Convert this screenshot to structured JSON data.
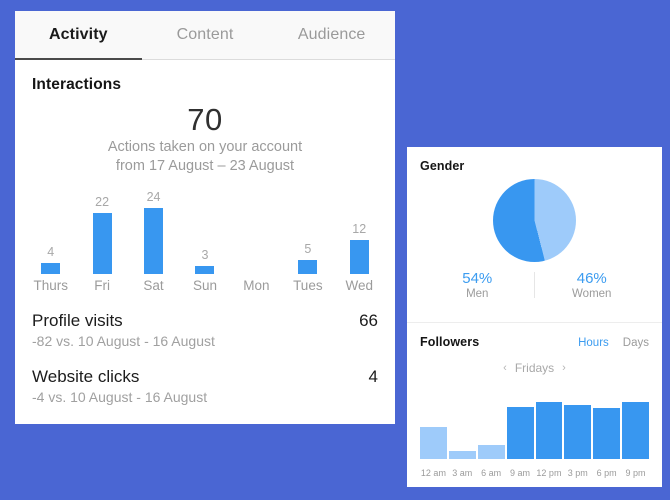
{
  "theme": {
    "background": "#4a66d3",
    "accent_blue": "#3897f0",
    "light_blue": "#9ecbfa",
    "text_dark": "#1c1c1c",
    "text_muted": "#9b9b9b"
  },
  "left_panel": {
    "tabs": [
      {
        "label": "Activity",
        "active": true
      },
      {
        "label": "Content",
        "active": false
      },
      {
        "label": "Audience",
        "active": false
      }
    ],
    "interactions": {
      "title": "Interactions",
      "total": "70",
      "subtitle_line1": "Actions taken on your account",
      "subtitle_line2": "from 17 August – 23 August"
    },
    "stats": [
      {
        "name": "Profile visits",
        "value": "66",
        "comparison": "-82 vs. 10 August - 16 August"
      },
      {
        "name": "Website clicks",
        "value": "4",
        "comparison": "-4 vs. 10 August - 16 August"
      }
    ]
  },
  "right_panel": {
    "gender": {
      "title": "Gender",
      "legend": [
        {
          "percent": "54%",
          "label": "Men"
        },
        {
          "percent": "46%",
          "label": "Women"
        }
      ]
    },
    "followers": {
      "title": "Followers",
      "toggle": [
        {
          "label": "Hours",
          "active": true
        },
        {
          "label": "Days",
          "active": false
        }
      ],
      "nav": {
        "prev_icon": "‹",
        "current": "Fridays",
        "next_icon": "›"
      }
    }
  },
  "chart_data": [
    {
      "type": "bar",
      "title": "Interactions",
      "xlabel": "",
      "ylabel": "",
      "categories": [
        "Thurs",
        "Fri",
        "Sat",
        "Sun",
        "Mon",
        "Tues",
        "Wed"
      ],
      "values": [
        4,
        22,
        24,
        3,
        0,
        5,
        12
      ],
      "value_labels": [
        "4",
        "22",
        "24",
        "3",
        "",
        "5",
        "12"
      ],
      "ylim": [
        0,
        24
      ],
      "grid": false,
      "legend": "none",
      "bar_color": "#3897f0"
    },
    {
      "type": "pie",
      "title": "Gender",
      "labels": [
        "Men",
        "Women"
      ],
      "values": [
        54,
        46
      ],
      "value_labels": [
        "54%",
        "46%"
      ],
      "colors": [
        "#3897f0",
        "#9ecbfa"
      ],
      "legend": "bottom"
    },
    {
      "type": "bar",
      "title": "Followers",
      "subtitle": "Fridays",
      "xlabel": "",
      "ylabel": "",
      "categories": [
        "12 am",
        "3 am",
        "6 am",
        "9 am",
        "12 pm",
        "3 pm",
        "6 pm",
        "9 pm"
      ],
      "values": [
        32,
        8,
        14,
        52,
        57,
        54,
        51,
        57
      ],
      "ylim": [
        0,
        60
      ],
      "grid": false,
      "legend": "none",
      "bar_colors": [
        "#9ecbfa",
        "#9ecbfa",
        "#9ecbfa",
        "#3897f0",
        "#3897f0",
        "#3897f0",
        "#3897f0",
        "#3897f0"
      ]
    }
  ]
}
